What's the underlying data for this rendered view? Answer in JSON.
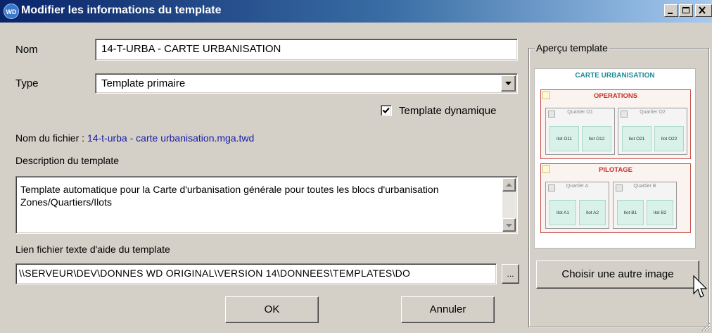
{
  "window": {
    "title": "Modifier les informations du template",
    "app_icon": "WD",
    "controls": [
      "minimize-icon",
      "maximize-icon",
      "close-icon"
    ]
  },
  "form": {
    "nom_label": "Nom",
    "nom_value": "14-T-URBA - CARTE URBANISATION",
    "type_label": "Type",
    "type_value": "Template primaire",
    "dynamic_label": "Template dynamique",
    "dynamic_checked": true,
    "filename_label": "Nom du fichier :",
    "filename_value": "14-t-urba - carte urbanisation.mga.twd",
    "description_label": "Description du template",
    "description_lines": [
      "Template automatique pour la Carte d'urbanisation générale pour toutes les blocs d'urbanisation",
      "Zones/Quartiers/Ilots"
    ],
    "help_label": "Lien fichier texte d'aide du template",
    "help_value": "\\\\SERVEUR\\DEV\\DONNES WD ORIGINAL\\VERSION 14\\DONNEES\\TEMPLATES\\DO",
    "browse_label": "..."
  },
  "buttons": {
    "ok": "OK",
    "cancel": "Annuler",
    "choose_image": "Choisir une autre image"
  },
  "preview": {
    "group_title": "Aperçu template",
    "title": "CARTE URBANISATION",
    "sections": [
      {
        "title": "OPERATIONS",
        "quartiers": [
          {
            "name": "Quartier O1",
            "ilots": [
              "Ilot O11",
              "Ilot O12"
            ]
          },
          {
            "name": "Quartier O2",
            "ilots": [
              "Ilot O21",
              "Ilot O22"
            ]
          }
        ]
      },
      {
        "title": "PILOTAGE",
        "quartiers": [
          {
            "name": "Quartier A",
            "ilots": [
              "Ilot A1",
              "Ilot A2"
            ]
          },
          {
            "name": "Quartier B",
            "ilots": [
              "Ilot B1",
              "Ilot B2"
            ]
          }
        ]
      }
    ]
  },
  "colors": {
    "dialog_bg": "#d4d0c8",
    "titlebar_start": "#0a246a",
    "titlebar_end": "#a6caf0",
    "filename_link": "#1a1aa6",
    "preview_title": "#1e8c9a",
    "preview_section": "#c83028"
  }
}
